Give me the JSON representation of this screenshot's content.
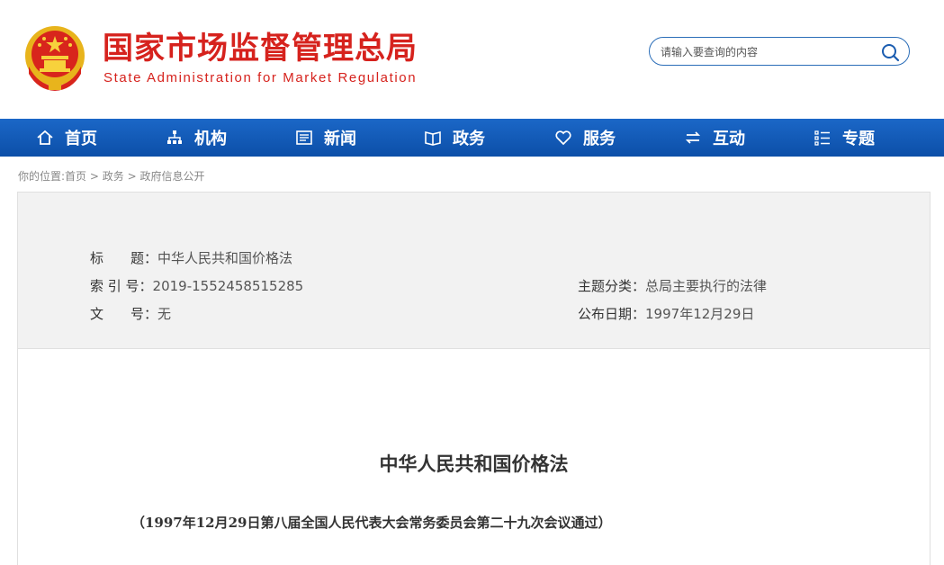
{
  "header": {
    "title": "国家市场监督管理总局",
    "subtitle": "State Administration for Market Regulation",
    "brand_color": "#d6221d"
  },
  "search": {
    "placeholder": "请输入要查询的内容",
    "icon": "search-icon"
  },
  "nav": {
    "items": [
      {
        "label": "首页",
        "icon": "home-icon"
      },
      {
        "label": "机构",
        "icon": "org-chart-icon"
      },
      {
        "label": "新闻",
        "icon": "newspaper-icon"
      },
      {
        "label": "政务",
        "icon": "book-icon"
      },
      {
        "label": "服务",
        "icon": "heart-icon"
      },
      {
        "label": "互动",
        "icon": "exchange-icon"
      },
      {
        "label": "专题",
        "icon": "list-icon"
      }
    ],
    "color": "#1b67c7"
  },
  "breadcrumb": {
    "prefix": "你的位置:",
    "items": [
      "首页",
      "政务",
      "政府信息公开"
    ],
    "separator": ">"
  },
  "meta": {
    "title_key": "标　　题：",
    "title_value": "中华人民共和国价格法",
    "index_key": "索 引 号：",
    "index_value": "2019-1552458515285",
    "docno_key": "文　　号：",
    "docno_value": "无",
    "topic_key": "主题分类：",
    "topic_value": "总局主要执行的法律",
    "date_key": "公布日期：",
    "date_value": "1997年12月29日"
  },
  "document": {
    "title": "中华人民共和国价格法",
    "subtitle": "（1997年12月29日第八届全国人民代表大会常务委员会第二十九次会议通过）"
  }
}
